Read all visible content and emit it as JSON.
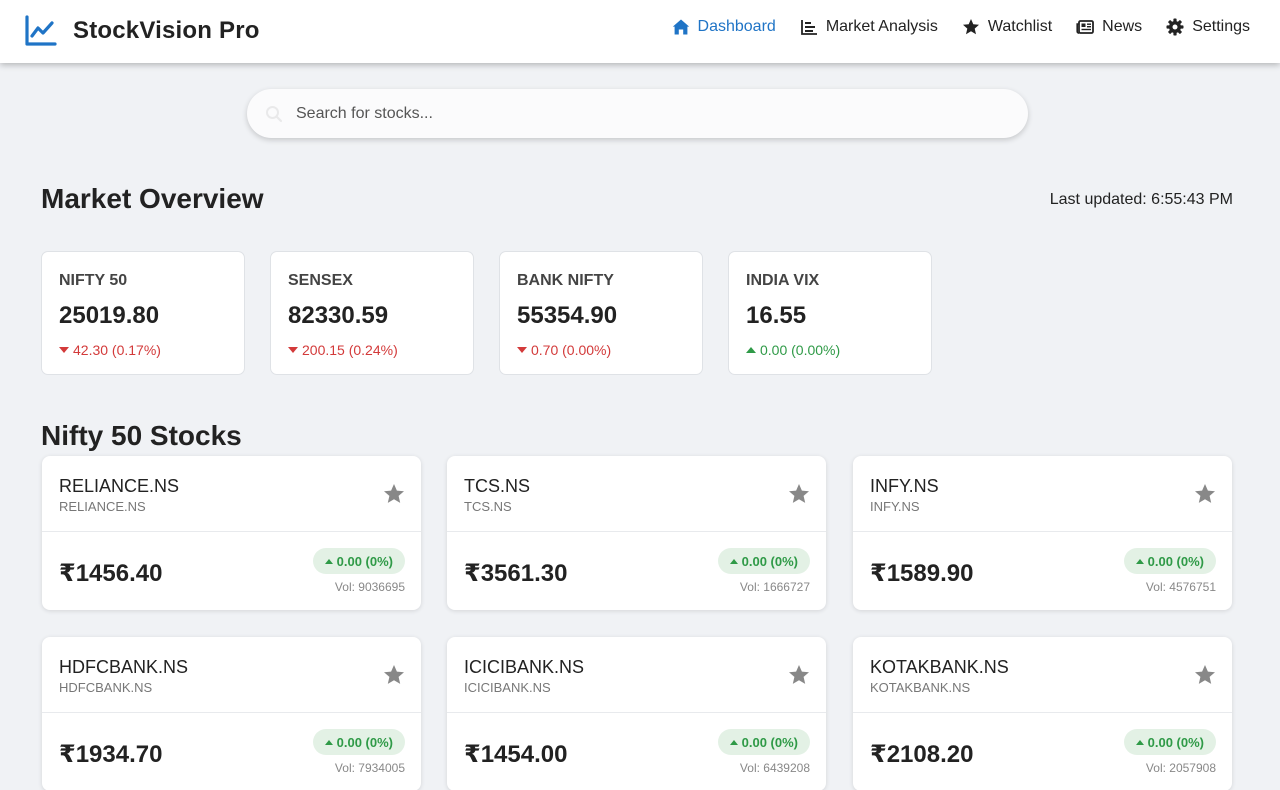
{
  "header": {
    "title": "StockVision Pro",
    "logo_icon": "chart-line-icon",
    "nav": [
      {
        "label": "Dashboard",
        "icon": "home-icon",
        "active": true
      },
      {
        "label": "Market Analysis",
        "icon": "chart-bar-icon",
        "active": false
      },
      {
        "label": "Watchlist",
        "icon": "star-icon",
        "active": false
      },
      {
        "label": "News",
        "icon": "newspaper-icon",
        "active": false
      },
      {
        "label": "Settings",
        "icon": "gear-icon",
        "active": false
      }
    ],
    "accent_color": "#1f74c6"
  },
  "search": {
    "placeholder": "Search for stocks...",
    "value": ""
  },
  "overview": {
    "title": "Market Overview",
    "last_updated": "Last updated: 6:55:43 PM",
    "indices": [
      {
        "name": "NIFTY 50",
        "value": "25019.80",
        "change": "42.30 (0.17%)",
        "direction": "down"
      },
      {
        "name": "SENSEX",
        "value": "82330.59",
        "change": "200.15 (0.24%)",
        "direction": "down"
      },
      {
        "name": "BANK NIFTY",
        "value": "55354.90",
        "change": "0.70 (0.00%)",
        "direction": "down"
      },
      {
        "name": "INDIA VIX",
        "value": "16.55",
        "change": "0.00 (0.00%)",
        "direction": "up"
      }
    ]
  },
  "stocks": {
    "title": "Nifty 50 Stocks",
    "items": [
      {
        "symbol": "RELIANCE.NS",
        "sub": "RELIANCE.NS",
        "price": "₹1456.40",
        "change": "0.00 (0%)",
        "volume": "Vol: 9036695"
      },
      {
        "symbol": "TCS.NS",
        "sub": "TCS.NS",
        "price": "₹3561.30",
        "change": "0.00 (0%)",
        "volume": "Vol: 1666727"
      },
      {
        "symbol": "INFY.NS",
        "sub": "INFY.NS",
        "price": "₹1589.90",
        "change": "0.00 (0%)",
        "volume": "Vol: 4576751"
      },
      {
        "symbol": "HDFCBANK.NS",
        "sub": "HDFCBANK.NS",
        "price": "₹1934.70",
        "change": "0.00 (0%)",
        "volume": "Vol: 7934005"
      },
      {
        "symbol": "ICICIBANK.NS",
        "sub": "ICICIBANK.NS",
        "price": "₹1454.00",
        "change": "0.00 (0%)",
        "volume": "Vol: 6439208"
      },
      {
        "symbol": "KOTAKBANK.NS",
        "sub": "KOTAKBANK.NS",
        "price": "₹2108.20",
        "change": "0.00 (0%)",
        "volume": "Vol: 2057908"
      }
    ]
  },
  "colors": {
    "down": "#d33a3a",
    "up": "#2f9a47",
    "up_bg": "#e3f1e5",
    "star": "#888888"
  }
}
